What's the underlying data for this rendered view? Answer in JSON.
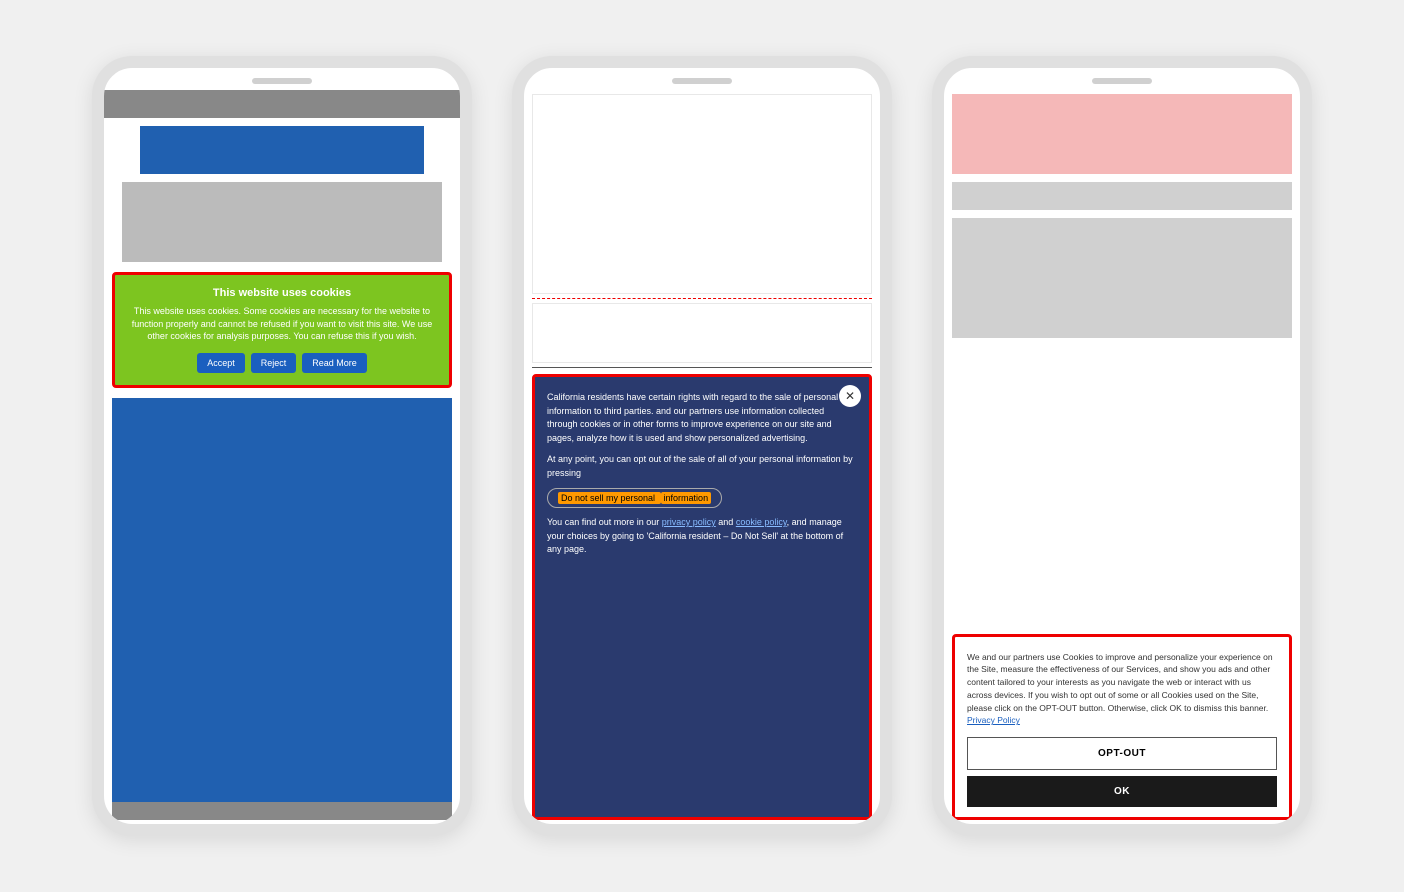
{
  "phone1": {
    "cookie_banner": {
      "title": "This website uses cookies",
      "body": "This website uses cookies. Some cookies are necessary for the website to function properly and cannot be refused if you want to visit this site. We use other cookies for analysis purposes. You can refuse this if you wish.",
      "accept_label": "Accept",
      "reject_label": "Reject",
      "read_more_label": "Read More"
    }
  },
  "phone2": {
    "cookie_banner": {
      "close_symbol": "✕",
      "paragraph1": "California residents have certain rights with regard to the sale of personal information to third parties.            and our partners use information collected through cookies or in other forms to improve experience on our site and pages, analyze how it is used and show personalized advertising.",
      "paragraph2": "At any point, you can opt out of the sale of all of your personal information by pressing",
      "do_not_sell_label": "Do not sell my personal information",
      "highlighted_word": "information",
      "footer_text": "You can find out more in our privacy policy and cookie policy, and manage your choices by going to 'California resident – Do Not Sell' at the bottom of any page.",
      "privacy_policy_link": "privacy policy",
      "cookie_policy_link": "cookie policy"
    }
  },
  "phone3": {
    "cookie_banner": {
      "body": "We and our partners use Cookies to improve and personalize your experience on the Site, measure the effectiveness of our Services, and show you ads and other content tailored to your interests as you navigate the web or interact with us across devices. If you wish to opt out of some or all Cookies used on the Site, please click on the OPT-OUT button. Otherwise, click OK to dismiss this banner.",
      "privacy_policy_link": "Privacy Policy",
      "opt_out_label": "OPT-OUT",
      "ok_label": "OK"
    }
  }
}
